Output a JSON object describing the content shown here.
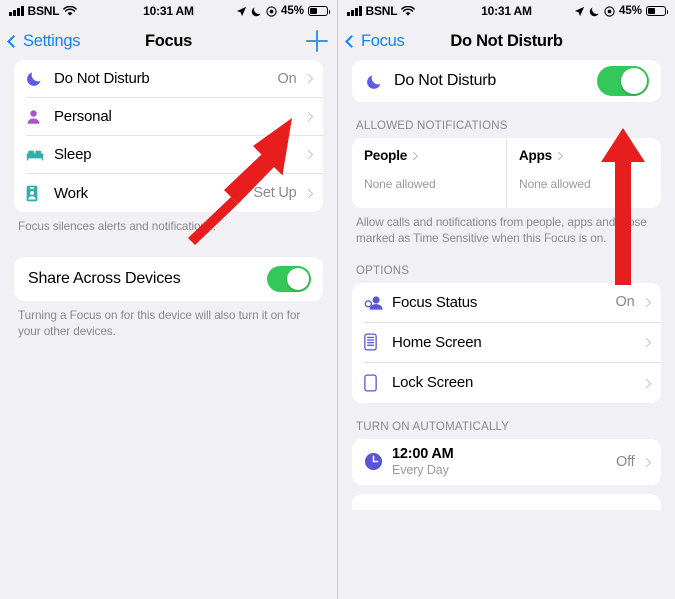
{
  "left_screen": {
    "status_bar": {
      "carrier": "BSNL",
      "time": "10:31 AM",
      "battery_percent": "45%",
      "icons": [
        "signal-bars-icon",
        "wifi-icon",
        "location-arrow-icon",
        "moon-icon",
        "focus-circle-icon",
        "battery-icon"
      ]
    },
    "nav": {
      "back_label": "Settings",
      "title": "Focus",
      "add_button": "+"
    },
    "focus_list": [
      {
        "label": "Do Not Disturb",
        "value": "On",
        "icon": "moon-icon",
        "icon_color": "#5e5ce6"
      },
      {
        "label": "Personal",
        "value": "",
        "icon": "person-icon",
        "icon_color": "#a855c8"
      },
      {
        "label": "Sleep",
        "value": "",
        "icon": "bed-icon",
        "icon_color": "#30b0a8"
      },
      {
        "label": "Work",
        "value": "Set Up",
        "icon": "badge-icon",
        "icon_color": "#30b0a8"
      }
    ],
    "focus_footnote": "Focus silences alerts and notifications.",
    "share_row": {
      "label": "Share Across Devices",
      "enabled": true
    },
    "share_footnote": "Turning a Focus on for this device will also turn it on for your other devices."
  },
  "right_screen": {
    "status_bar": {
      "carrier": "BSNL",
      "time": "10:31 AM",
      "battery_percent": "45%"
    },
    "nav": {
      "back_label": "Focus",
      "title": "Do Not Disturb"
    },
    "dnd_row": {
      "label": "Do Not Disturb",
      "icon": "moon-icon",
      "enabled": true
    },
    "allowed_notifications": {
      "header": "ALLOWED NOTIFICATIONS",
      "columns": [
        {
          "title": "People",
          "subtitle": "None allowed"
        },
        {
          "title": "Apps",
          "subtitle": "None allowed"
        }
      ],
      "footnote": "Allow calls and notifications from people, apps and those marked as Time Sensitive when this Focus is on."
    },
    "options": {
      "header": "OPTIONS",
      "rows": [
        {
          "label": "Focus Status",
          "value": "On",
          "icon": "focus-status-icon"
        },
        {
          "label": "Home Screen",
          "value": "",
          "icon": "home-screen-icon"
        },
        {
          "label": "Lock Screen",
          "value": "",
          "icon": "lock-screen-icon"
        }
      ]
    },
    "turn_on_automatically": {
      "header": "TURN ON AUTOMATICALLY",
      "rows": [
        {
          "title": "12:00 AM",
          "subtitle": "Every Day",
          "value": "Off",
          "icon": "clock-icon"
        }
      ]
    }
  },
  "annotations": {
    "arrow_color": "#e81e1e",
    "left_arrow_target": "Do Not Disturb On value",
    "right_arrow_target": "Do Not Disturb toggle"
  },
  "colors": {
    "accent_blue": "#0a84ff",
    "toggle_green": "#34c759",
    "indigo": "#5e5ce6",
    "background": "#f1f1f5",
    "card": "#ffffff",
    "secondary_text": "#8a8a8e"
  }
}
